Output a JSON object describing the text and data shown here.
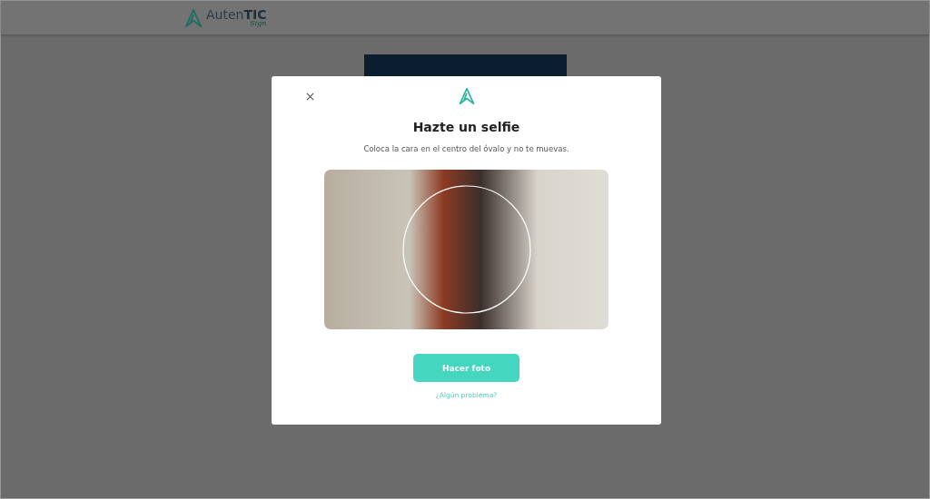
{
  "header": {
    "logo": {
      "text_regular": "Auten",
      "text_bold": "TIC",
      "tagline": "Sign"
    }
  },
  "modal": {
    "title": "Hazte un selfie",
    "instruction": "Coloca la cara en el centro del óvalo y no te muevas.",
    "primary_button": "Hacer foto",
    "help_link": "¿Algún problema?"
  }
}
